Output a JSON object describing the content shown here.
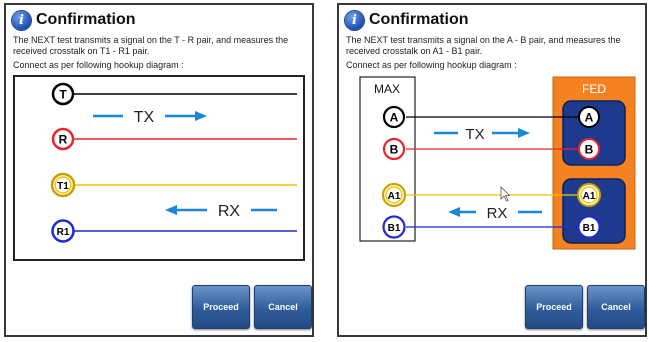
{
  "left_dialog": {
    "title": "Confirmation",
    "description": "The NEXT test transmits a signal on the T - R pair, and measures the received crosstalk on T1 - R1 pair.",
    "instruction": "Connect as per following hookup diagram :",
    "diagram": {
      "pins": [
        "T",
        "R",
        "T1",
        "R1"
      ],
      "tx_label": "TX",
      "rx_label": "RX"
    },
    "buttons": {
      "proceed": "Proceed",
      "cancel": "Cancel"
    }
  },
  "right_dialog": {
    "title": "Confirmation",
    "description": "The NEXT test transmits a signal on the A - B pair, and measures the received crosstalk on A1 - B1 pair.",
    "instruction": "Connect as per following hookup diagram :",
    "diagram": {
      "max_label": "MAX",
      "fed_label": "FED",
      "max_pins": [
        "A",
        "B",
        "A1",
        "B1"
      ],
      "fed_pins": [
        "A",
        "B",
        "A1",
        "B1"
      ],
      "tx_label": "TX",
      "rx_label": "RX"
    },
    "buttons": {
      "proceed": "Proceed",
      "cancel": "Cancel"
    }
  },
  "colors": {
    "black_wire": "#000000",
    "red_wire": "#e8262b",
    "yellow_wire": "#f5c400",
    "blue_wire": "#1f2bd1",
    "arrow": "#1b86d6",
    "fed_orange": "#f58220",
    "fed_box": "#1e3a8e"
  }
}
